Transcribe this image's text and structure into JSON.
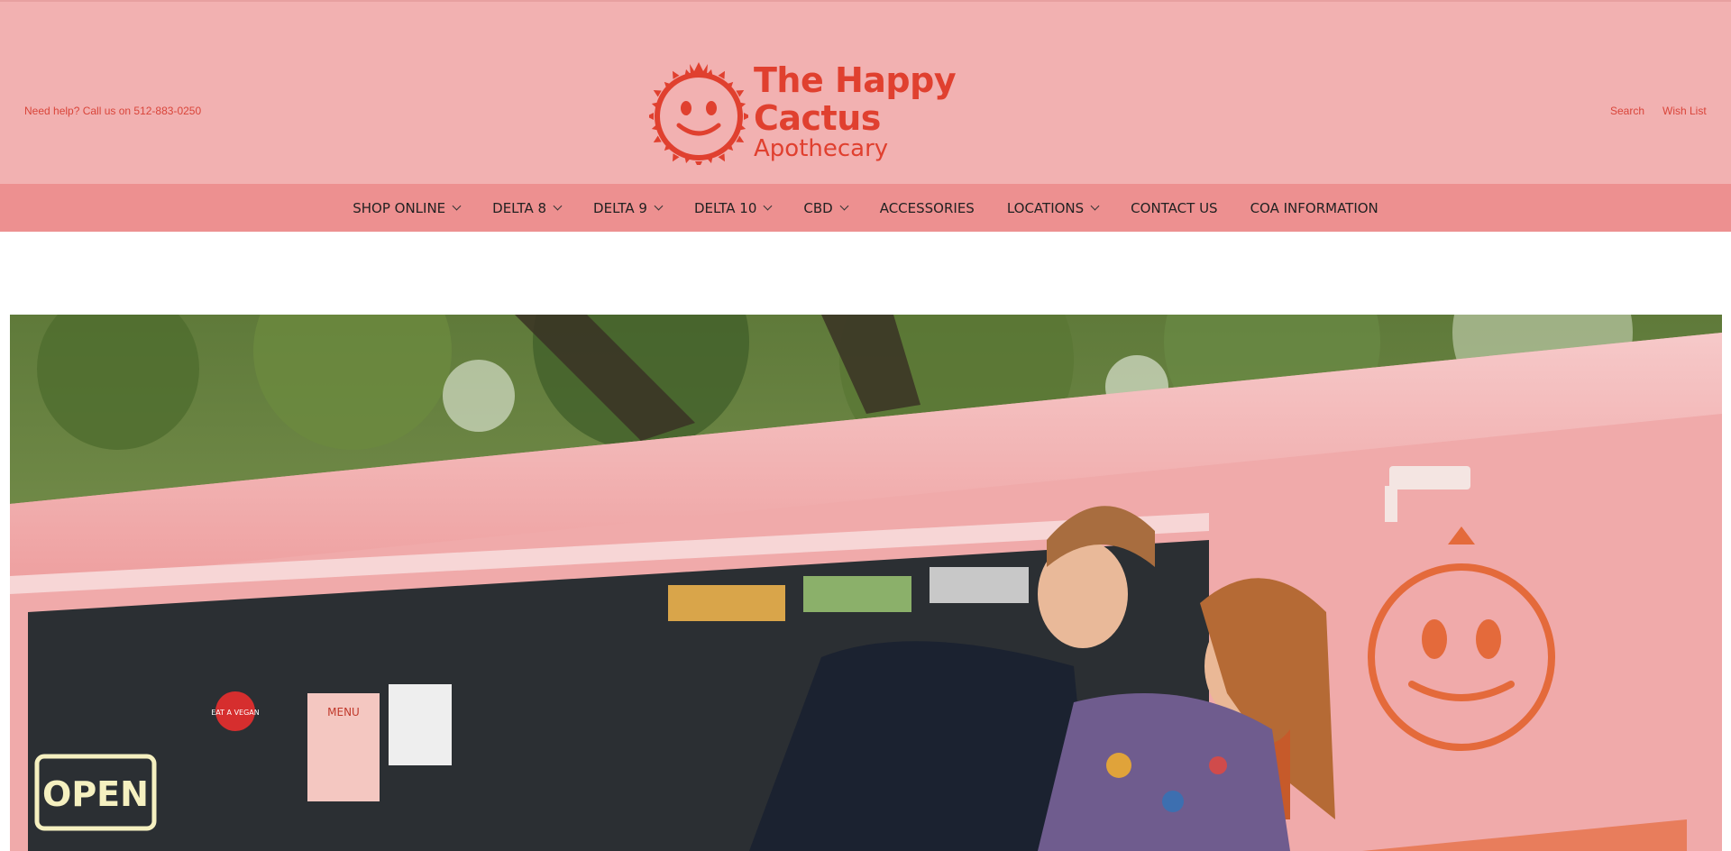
{
  "header": {
    "help_text": "Need help? Call us on 512-883-0250",
    "logo": {
      "title": "The Happy Cactus",
      "subtitle": "Apothecary",
      "icon": "smiling-sun-logo-icon",
      "color": "#e0402f"
    },
    "utility_links": {
      "search": "Search",
      "wish_list": "Wish List"
    },
    "background": "#f2b1b1"
  },
  "nav": {
    "background": "#ed9090",
    "items": [
      {
        "label": "SHOP ONLINE",
        "has_dropdown": true
      },
      {
        "label": "DELTA 8",
        "has_dropdown": true
      },
      {
        "label": "DELTA 9",
        "has_dropdown": true
      },
      {
        "label": "DELTA 10",
        "has_dropdown": true
      },
      {
        "label": "CBD",
        "has_dropdown": true
      },
      {
        "label": "ACCESSORIES",
        "has_dropdown": false
      },
      {
        "label": "LOCATIONS",
        "has_dropdown": true
      },
      {
        "label": "CONTACT US",
        "has_dropdown": false
      },
      {
        "label": "COA INFORMATION",
        "has_dropdown": false
      }
    ]
  },
  "hero": {
    "sign_text": "OPEN",
    "menu_text": "MENU",
    "sticker_text": "EAT A VEGAN"
  }
}
